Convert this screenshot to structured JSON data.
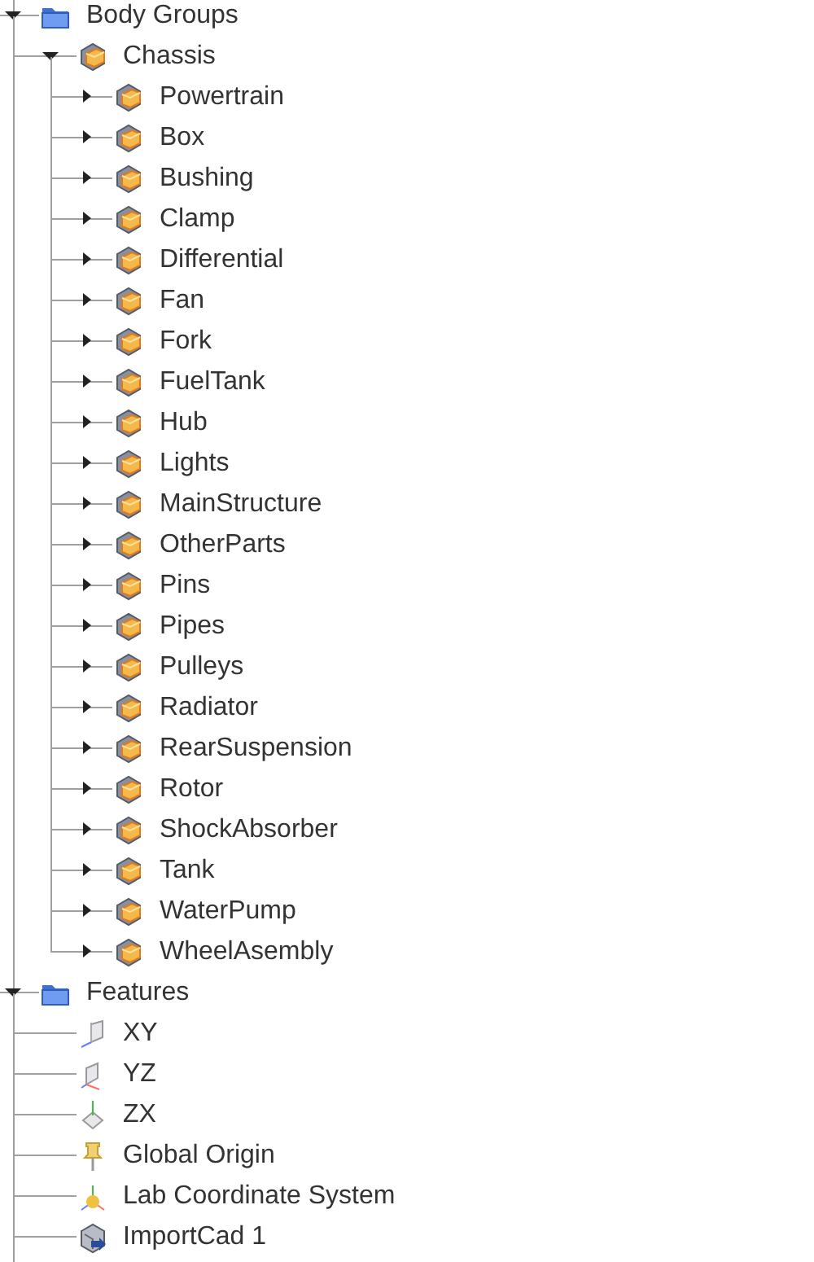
{
  "tree": [
    {
      "label": "Body Groups",
      "kind": "folder",
      "expanded": true,
      "children": [
        {
          "label": "Chassis",
          "kind": "body",
          "expanded": true,
          "children": [
            {
              "label": "Powertrain",
              "kind": "body",
              "expanded": false
            },
            {
              "label": "Box",
              "kind": "body",
              "expanded": false
            },
            {
              "label": "Bushing",
              "kind": "body",
              "expanded": false
            },
            {
              "label": "Clamp",
              "kind": "body",
              "expanded": false
            },
            {
              "label": "Differential",
              "kind": "body",
              "expanded": false
            },
            {
              "label": "Fan",
              "kind": "body",
              "expanded": false
            },
            {
              "label": "Fork",
              "kind": "body",
              "expanded": false
            },
            {
              "label": "FuelTank",
              "kind": "body",
              "expanded": false
            },
            {
              "label": "Hub",
              "kind": "body",
              "expanded": false
            },
            {
              "label": "Lights",
              "kind": "body",
              "expanded": false
            },
            {
              "label": "MainStructure",
              "kind": "body",
              "expanded": false
            },
            {
              "label": "OtherParts",
              "kind": "body",
              "expanded": false
            },
            {
              "label": "Pins",
              "kind": "body",
              "expanded": false
            },
            {
              "label": "Pipes",
              "kind": "body",
              "expanded": false
            },
            {
              "label": "Pulleys",
              "kind": "body",
              "expanded": false
            },
            {
              "label": "Radiator",
              "kind": "body",
              "expanded": false
            },
            {
              "label": "RearSuspension",
              "kind": "body",
              "expanded": false
            },
            {
              "label": "Rotor",
              "kind": "body",
              "expanded": false
            },
            {
              "label": "ShockAbsorber",
              "kind": "body",
              "expanded": false
            },
            {
              "label": "Tank",
              "kind": "body",
              "expanded": false
            },
            {
              "label": "WaterPump",
              "kind": "body",
              "expanded": false
            },
            {
              "label": "WheelAsembly",
              "kind": "body",
              "expanded": false
            }
          ]
        }
      ]
    },
    {
      "label": "Features",
      "kind": "folder",
      "expanded": true,
      "children": [
        {
          "label": "XY",
          "kind": "plane-xy"
        },
        {
          "label": "YZ",
          "kind": "plane-yz"
        },
        {
          "label": "ZX",
          "kind": "plane-zx"
        },
        {
          "label": "Global Origin",
          "kind": "pin"
        },
        {
          "label": "Lab Coordinate System",
          "kind": "coordinate-system"
        },
        {
          "label": "ImportCad 1",
          "kind": "import-cad"
        }
      ]
    }
  ]
}
